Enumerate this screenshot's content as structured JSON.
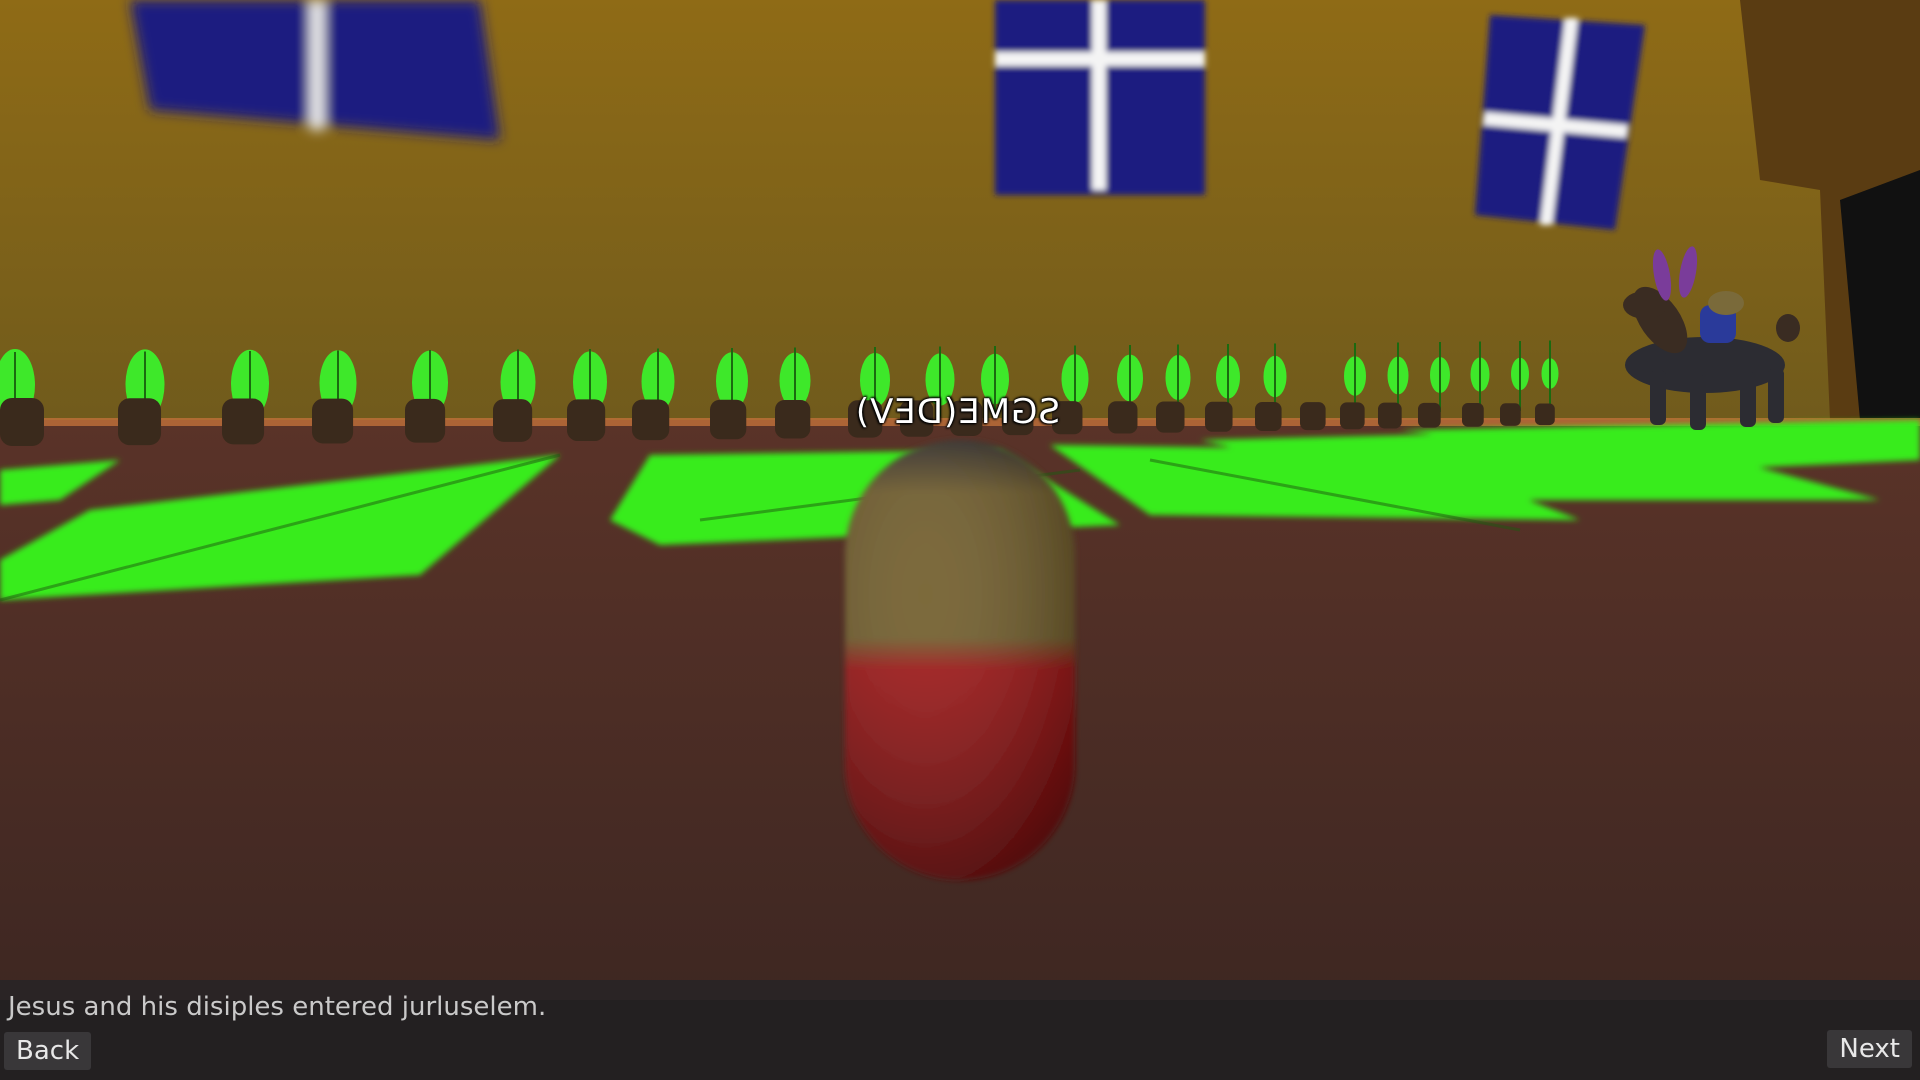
{
  "scene": {
    "player_nametag": "SGME(DEV)"
  },
  "dialog": {
    "text": "Jesus and his disiples entered jurluselem.",
    "back_label": "Back",
    "next_label": "Next"
  },
  "colors": {
    "wall": "#8a6a1a",
    "floor": "#4a2a22",
    "grass": "#33e81a",
    "window": "#1a1a7a",
    "capsule_top": "#6e5a22",
    "capsule_bottom": "#8a0a0a"
  }
}
